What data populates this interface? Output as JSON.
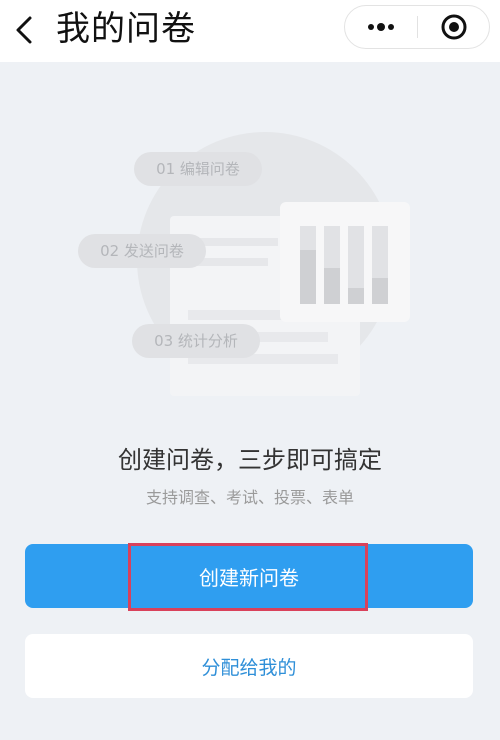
{
  "header": {
    "title": "我的问卷",
    "back_icon": "chevron-left-icon",
    "more_icon": "more-dots-icon",
    "close_icon": "target-circle-icon"
  },
  "illustration": {
    "steps": [
      {
        "label": "01  编辑问卷"
      },
      {
        "label": "02  发送问卷"
      },
      {
        "label": "03  统计分析"
      }
    ]
  },
  "main": {
    "headline": "创建问卷，三步即可搞定",
    "subline": "支持调查、考试、投票、表单"
  },
  "actions": {
    "create_label": "创建新问卷",
    "assigned_label": "分配给我的"
  },
  "colors": {
    "primary": "#2f9ef0",
    "highlight": "#d9415b",
    "background": "#eef1f5"
  }
}
